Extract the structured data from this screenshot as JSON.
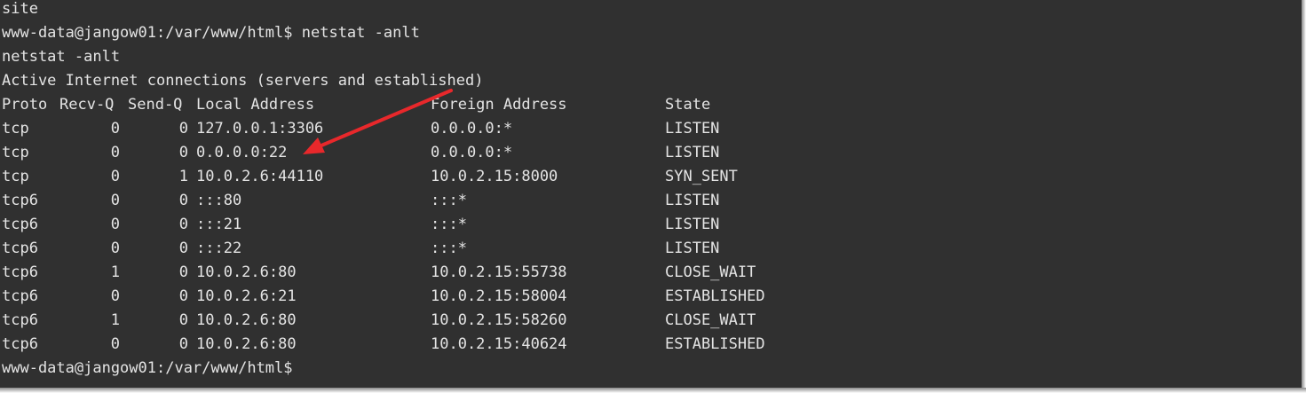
{
  "terminal": {
    "line_site": "site",
    "prompt1": "www-data@jangow01:/var/www/html$ netstat -anlt",
    "echo_cmd": "netstat -anlt",
    "heading": "Active Internet connections (servers and established)",
    "headers": {
      "proto": "Proto",
      "recvq": "Recv-Q",
      "sendq": "Send-Q",
      "local": "Local Address",
      "foreign": "Foreign Address",
      "state": "State"
    },
    "rows": [
      {
        "proto": "tcp",
        "recvq": "0",
        "sendq": "0",
        "local": "127.0.0.1:3306",
        "foreign": "0.0.0.0:*",
        "state": "LISTEN"
      },
      {
        "proto": "tcp",
        "recvq": "0",
        "sendq": "0",
        "local": "0.0.0.0:22",
        "foreign": "0.0.0.0:*",
        "state": "LISTEN"
      },
      {
        "proto": "tcp",
        "recvq": "0",
        "sendq": "1",
        "local": "10.0.2.6:44110",
        "foreign": "10.0.2.15:8000",
        "state": "SYN_SENT"
      },
      {
        "proto": "tcp6",
        "recvq": "0",
        "sendq": "0",
        "local": ":::80",
        "foreign": ":::*",
        "state": "LISTEN"
      },
      {
        "proto": "tcp6",
        "recvq": "0",
        "sendq": "0",
        "local": ":::21",
        "foreign": ":::*",
        "state": "LISTEN"
      },
      {
        "proto": "tcp6",
        "recvq": "0",
        "sendq": "0",
        "local": ":::22",
        "foreign": ":::*",
        "state": "LISTEN"
      },
      {
        "proto": "tcp6",
        "recvq": "1",
        "sendq": "0",
        "local": "10.0.2.6:80",
        "foreign": "10.0.2.15:55738",
        "state": "CLOSE_WAIT"
      },
      {
        "proto": "tcp6",
        "recvq": "0",
        "sendq": "0",
        "local": "10.0.2.6:21",
        "foreign": "10.0.2.15:58004",
        "state": "ESTABLISHED"
      },
      {
        "proto": "tcp6",
        "recvq": "1",
        "sendq": "0",
        "local": "10.0.2.6:80",
        "foreign": "10.0.2.15:58260",
        "state": "CLOSE_WAIT"
      },
      {
        "proto": "tcp6",
        "recvq": "0",
        "sendq": "0",
        "local": "10.0.2.6:80",
        "foreign": "10.0.2.15:40624",
        "state": "ESTABLISHED"
      }
    ],
    "prompt_final": "www-data@jangow01:/var/www/html$"
  },
  "annotation": {
    "icon": "red-arrow-icon",
    "color": "#e8282b"
  },
  "colors": {
    "background": "#303030",
    "text": "#e4e4e4"
  }
}
